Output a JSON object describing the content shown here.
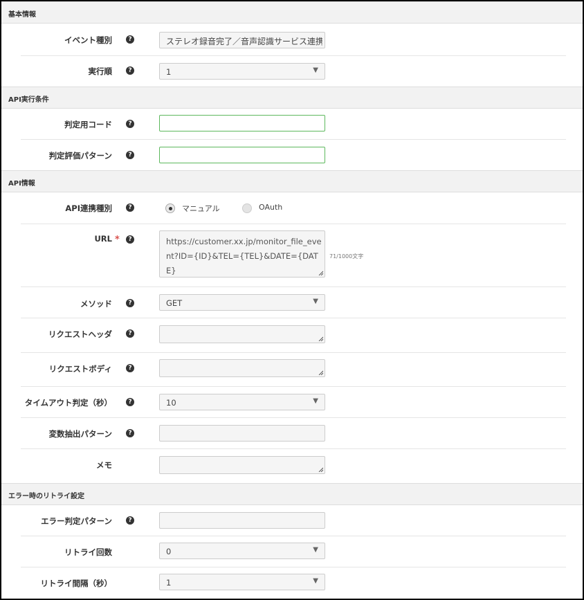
{
  "sections": {
    "basic": "基本情報",
    "condition": "API実行条件",
    "api": "API情報",
    "retry": "エラー時のリトライ設定"
  },
  "help_glyph": "?",
  "required_mark": "*",
  "select_arrow": "▼",
  "fields": {
    "event_type": {
      "label": "イベント種別",
      "value": "ステレオ録音完了／音声認識サービス連携完"
    },
    "exec_order": {
      "label": "実行順",
      "value": "1"
    },
    "judge_code": {
      "label": "判定用コード",
      "value": ""
    },
    "judge_pattern": {
      "label": "判定評価パターン",
      "value": ""
    },
    "api_link_type": {
      "label": "API連携種別",
      "options": [
        "マニュアル",
        "OAuth"
      ],
      "selected": "マニュアル"
    },
    "url": {
      "label": "URL",
      "value": "https://customer.xx.jp/monitor_file_event?ID={ID}&TEL={TEL}&DATE={DATE}",
      "counter": "71/1000文字"
    },
    "method": {
      "label": "メソッド",
      "value": "GET"
    },
    "request_header": {
      "label": "リクエストヘッダ",
      "value": ""
    },
    "request_body": {
      "label": "リクエストボディ",
      "value": ""
    },
    "timeout": {
      "label": "タイムアウト判定（秒）",
      "value": "10"
    },
    "var_pattern": {
      "label": "変数抽出パターン",
      "value": ""
    },
    "memo": {
      "label": "メモ",
      "value": ""
    },
    "error_pattern": {
      "label": "エラー判定パターン",
      "value": ""
    },
    "retry_count": {
      "label": "リトライ回数",
      "value": "0"
    },
    "retry_interval": {
      "label": "リトライ間隔（秒）",
      "value": "1"
    }
  }
}
